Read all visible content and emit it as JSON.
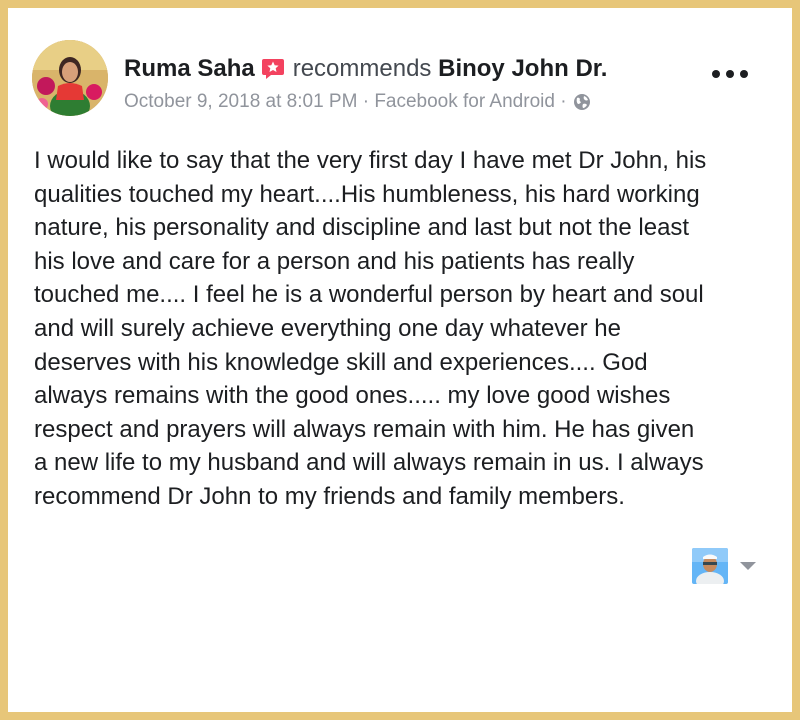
{
  "post": {
    "author": "Ruma Saha",
    "action": "recommends",
    "target": "Binoy John Dr.",
    "date": "October 9, 2018 at 8:01 PM",
    "separator": "·",
    "source": "Facebook for Android",
    "body": "I would like to say that the very first day I have met Dr John, his\nqualities touched my heart....His humbleness, his hard working\nnature, his personality and discipline and last but not the least\nhis love and care for a person and his patients has really\ntouched me.... I feel he is a wonderful person by heart and soul\nand will surely achieve everything one day whatever he\ndeserves with his knowledge skill and experiences.... God\nalways remains with the good ones..... my love good wishes\nrespect and prayers will always remain with him. He has given\na new life to my husband and will always remain in us. I always\nrecommend Dr John to my friends and family members."
  },
  "icons": {
    "recommend": "recommend-star-icon",
    "privacy": "globe-icon",
    "more": "more-options-icon",
    "dropdown": "chevron-down-icon"
  },
  "colors": {
    "frame": "#e7c679",
    "recommend_badge": "#f3425f",
    "meta_text": "#90949c"
  }
}
